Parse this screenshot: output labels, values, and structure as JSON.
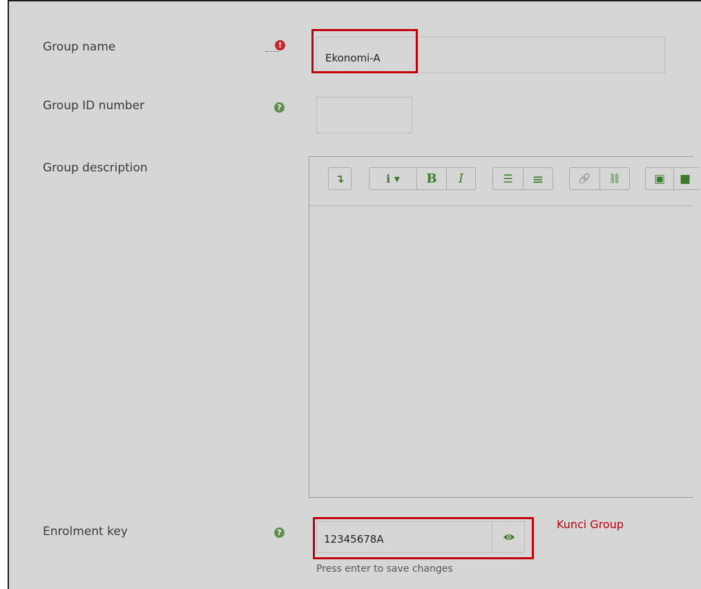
{
  "form": {
    "group_name": {
      "label": "Group name",
      "value": "Ekonomi-A"
    },
    "group_id": {
      "label": "Group ID number",
      "value": ""
    },
    "group_description": {
      "label": "Group description"
    },
    "enrolment_key": {
      "label": "Enrolment key",
      "value": "12345678A",
      "hint": "Press enter to save changes"
    }
  },
  "icons": {
    "required": "!",
    "help": "?"
  },
  "toolbar": {
    "groups": [
      [
        "collapse-icon"
      ],
      [
        "paragraph-style-icon",
        "bold-icon",
        "italic-icon"
      ],
      [
        "unordered-list-icon",
        "ordered-list-icon"
      ],
      [
        "link-icon",
        "unlink-icon"
      ],
      [
        "image-icon",
        "media-icon"
      ]
    ],
    "glyphs": {
      "collapse": "↴",
      "paragraph": "i ▾",
      "bold": "B",
      "italic": "I",
      "ul": "☰",
      "ol": "≡",
      "link": "🔗",
      "unlink": "⛓",
      "image": "▣",
      "media": "■"
    }
  },
  "annotation": {
    "text": "Kunci Group"
  },
  "colors": {
    "accent_green": "#3e7a2e",
    "highlight_red": "#c1000b",
    "background": "#d6d6d6"
  }
}
